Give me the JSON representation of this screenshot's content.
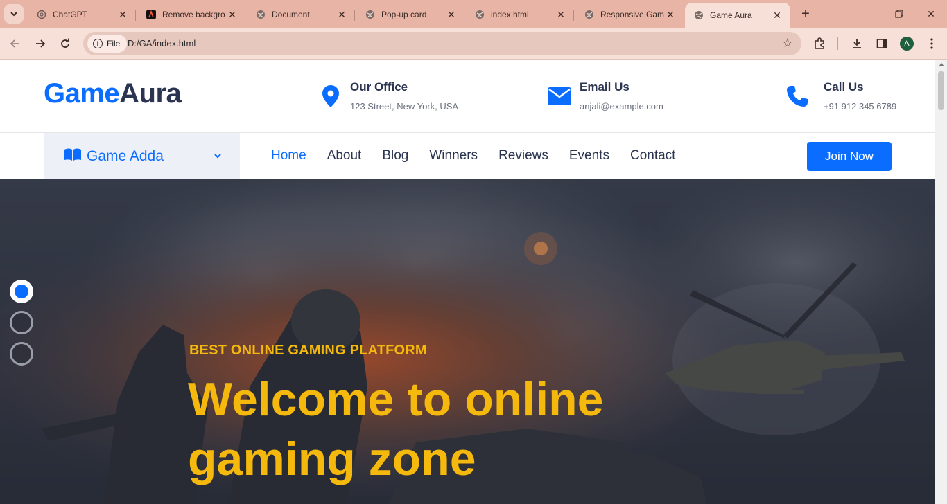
{
  "browser": {
    "tabs": [
      {
        "title": "ChatGPT",
        "icon": "chatgpt-icon"
      },
      {
        "title": "Remove backgro",
        "icon": "adobe-icon"
      },
      {
        "title": "Document",
        "icon": "globe-icon"
      },
      {
        "title": "Pop-up card",
        "icon": "globe-icon"
      },
      {
        "title": "index.html",
        "icon": "globe-icon"
      },
      {
        "title": "Responsive Gam",
        "icon": "globe-icon"
      },
      {
        "title": "Game Aura",
        "icon": "globe-icon",
        "active": true
      }
    ],
    "chip_label": "File",
    "url": "D:/GA/index.html",
    "profile_initial": "A"
  },
  "site": {
    "logo_part1": "Game",
    "logo_part2": "Aura",
    "contacts": [
      {
        "title": "Our Office",
        "detail": "123 Street, New York, USA",
        "icon": "map-marker-icon"
      },
      {
        "title": "Email Us",
        "detail": "anjali@example.com",
        "icon": "envelope-icon"
      },
      {
        "title": "Call Us",
        "detail": "+91 912 345 6789",
        "icon": "phone-icon"
      }
    ],
    "dropdown_label": "Game Adda",
    "nav": [
      {
        "label": "Home",
        "active": true
      },
      {
        "label": "About"
      },
      {
        "label": "Blog"
      },
      {
        "label": "Winners"
      },
      {
        "label": "Reviews"
      },
      {
        "label": "Events"
      },
      {
        "label": "Contact"
      }
    ],
    "join_label": "Join Now"
  },
  "hero": {
    "kicker": "BEST ONLINE GAMING PLATFORM",
    "title": "Welcome to online gaming zone",
    "slides": 3,
    "active_slide": 1
  },
  "colors": {
    "brand_blue": "#0a6dff",
    "dark_navy": "#2b3450",
    "hero_yellow": "#f5b80d",
    "tabbar": "#e8b4a6"
  }
}
